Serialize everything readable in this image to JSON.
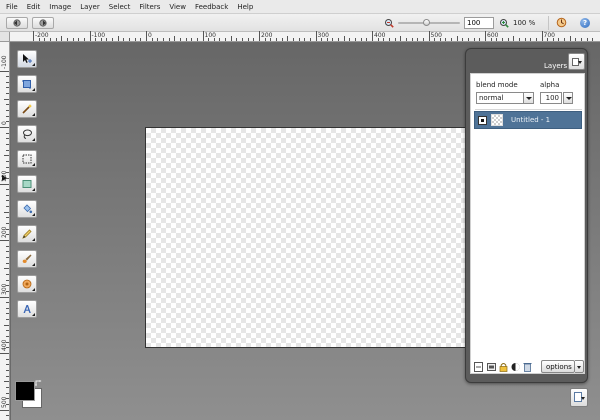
{
  "menu": {
    "items": [
      {
        "name": "menu-file",
        "label": "File"
      },
      {
        "name": "menu-edit",
        "label": "Edit"
      },
      {
        "name": "menu-image",
        "label": "Image"
      },
      {
        "name": "menu-layer",
        "label": "Layer"
      },
      {
        "name": "menu-select",
        "label": "Select"
      },
      {
        "name": "menu-filters",
        "label": "Filters"
      },
      {
        "name": "menu-view",
        "label": "View"
      },
      {
        "name": "menu-feedback",
        "label": "Feedback"
      },
      {
        "name": "menu-help",
        "label": "Help"
      }
    ]
  },
  "toolbar": {
    "undo_icon": "undo-icon",
    "redo_icon": "redo-icon",
    "zoom_value": "100",
    "zoom_readout": "100 %",
    "zoom_slider_fraction": 0.45,
    "help_glyph": "?"
  },
  "rulers": {
    "horizontal": [
      "-200",
      "-100",
      "0",
      "100",
      "200",
      "300",
      "400",
      "500",
      "600",
      "700"
    ],
    "vertical": [
      "-100",
      "0",
      "100",
      "200",
      "300",
      "400",
      "500"
    ]
  },
  "tools": [
    "move-tool",
    "crop-tool",
    "magic-wand-tool",
    "lasso-tool",
    "marquee-tool",
    "shape-tool",
    "paint-bucket-tool",
    "pencil-tool",
    "brush-tool",
    "stamp-tool",
    "text-tool"
  ],
  "colors": {
    "foreground": "#000000",
    "background": "#ffffff",
    "selected_layer": "#4f7397"
  },
  "layers": {
    "title": "Layers",
    "blend_label": "blend mode",
    "alpha_label": "alpha",
    "blend_mode": "normal",
    "alpha_value": "100",
    "items": [
      {
        "name": "Untitled - 1",
        "visible": true,
        "selected": true
      }
    ],
    "options_label": "options"
  }
}
